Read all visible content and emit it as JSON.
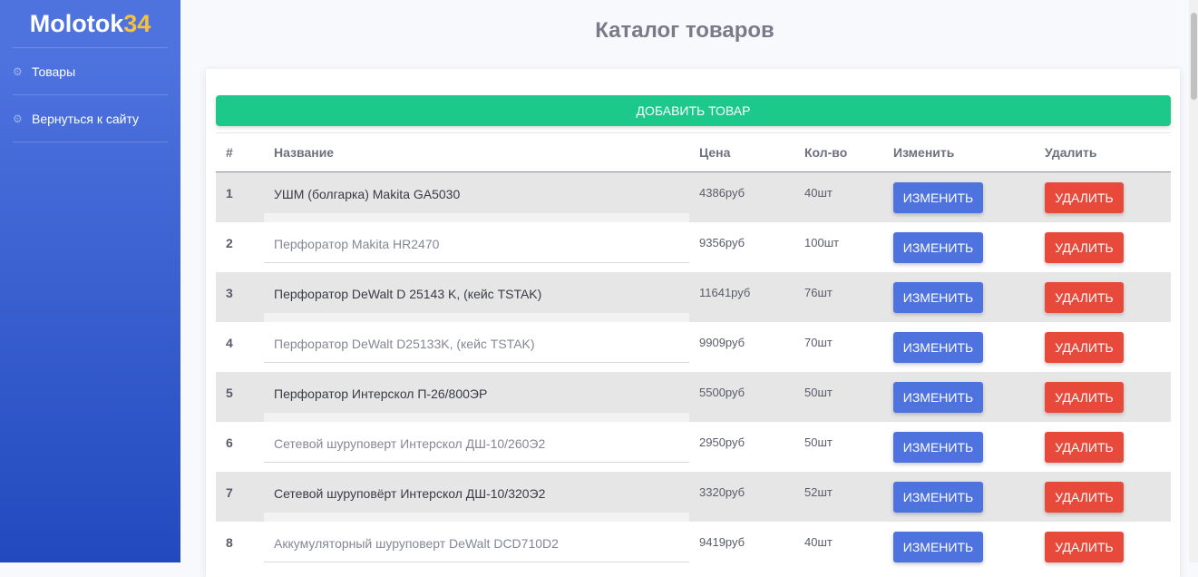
{
  "brand": {
    "text": "Molotok",
    "num": "34",
    "accent": "#f6c23e"
  },
  "sidebar": {
    "items": [
      {
        "label": "Товары",
        "icon": "gear-icon"
      },
      {
        "label": "Вернуться к сайту",
        "icon": "gear-icon"
      }
    ]
  },
  "page": {
    "title": "Каталог товаров"
  },
  "toolbar": {
    "add_label": "ДОБАВИТЬ ТОВАР"
  },
  "table": {
    "headers": [
      "#",
      "Название",
      "Цена",
      "Кол-во",
      "Изменить",
      "Удалить"
    ],
    "edit_label": "ИЗМЕНИТЬ",
    "delete_label": "УДАЛИТЬ",
    "rows": [
      {
        "num": "1",
        "name": "УШМ (болгарка) Makita GA5030",
        "price": "4386руб",
        "qty": "40шт"
      },
      {
        "num": "2",
        "name": "Перфоратор Makita HR2470",
        "price": "9356руб",
        "qty": "100шт"
      },
      {
        "num": "3",
        "name": "Перфоратор DeWalt D 25143 K, (кейс TSTAK)",
        "price": "11641руб",
        "qty": "76шт"
      },
      {
        "num": "4",
        "name": "Перфоратор DeWalt D25133K, (кейс TSTAK)",
        "price": "9909руб",
        "qty": "70шт"
      },
      {
        "num": "5",
        "name": "Перфоратор Интерскол П-26/800ЭР",
        "price": "5500руб",
        "qty": "50шт"
      },
      {
        "num": "6",
        "name": "Сетевой шуруповерт Интерскол ДШ-10/260Э2",
        "price": "2950руб",
        "qty": "50шт"
      },
      {
        "num": "7",
        "name": "Сетевой шуруповёрт Интерскол ДШ-10/320Э2",
        "price": "3320руб",
        "qty": "52шт"
      },
      {
        "num": "8",
        "name": "Аккумуляторный шуруповерт DeWalt DCD710D2",
        "price": "9419руб",
        "qty": "40шт"
      }
    ]
  },
  "colors": {
    "sidebar_top": "#4e73df",
    "sidebar_bottom": "#224abe",
    "add_button": "#1cc88a",
    "edit_button": "#4e73df",
    "delete_button": "#e74a3b"
  }
}
